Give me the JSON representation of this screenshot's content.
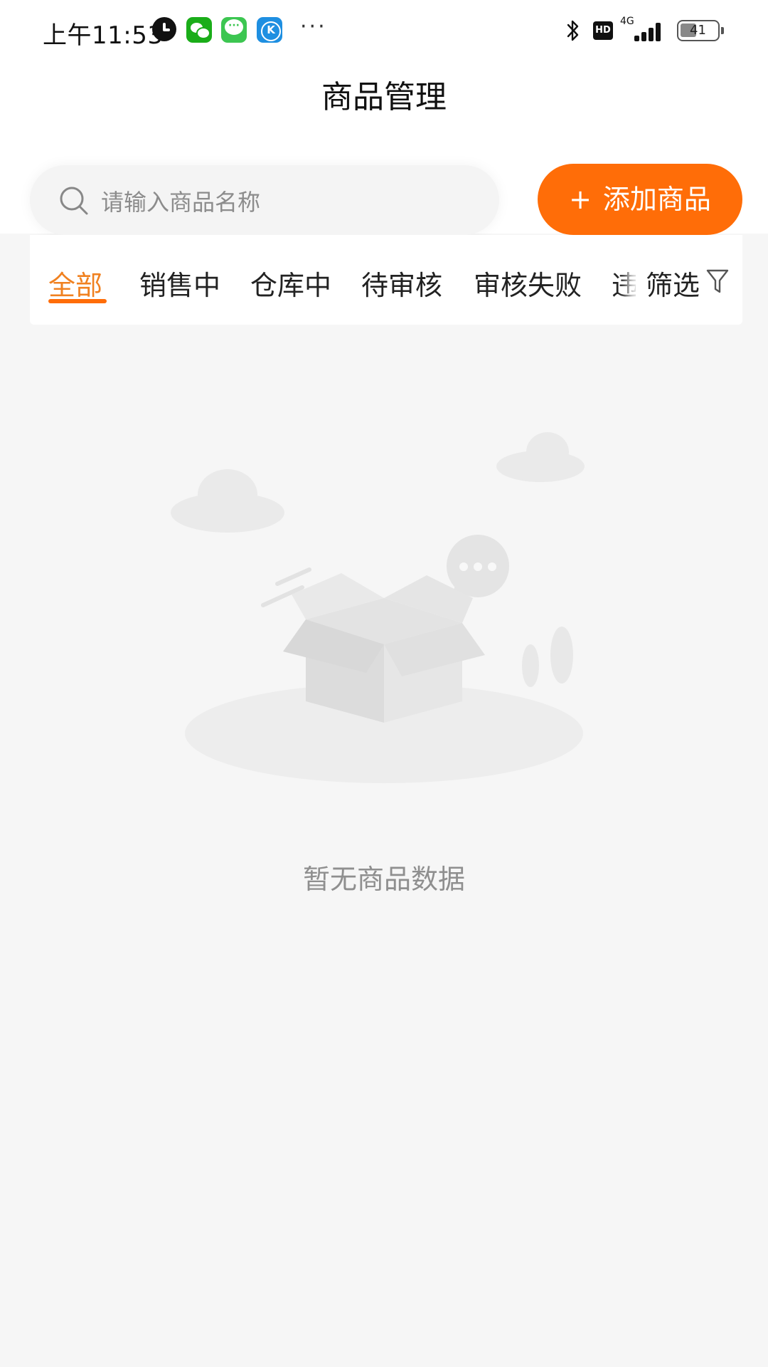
{
  "status_bar": {
    "time": "上午11:53",
    "network": "4G",
    "hd": "HD",
    "battery": "41",
    "more": "···",
    "icons": [
      "alarm-icon",
      "wechat-icon",
      "message-icon",
      "k-app-icon",
      "bluetooth-icon",
      "signal-icon",
      "battery-icon"
    ]
  },
  "header": {
    "title": "商品管理"
  },
  "search": {
    "placeholder": "请输入商品名称"
  },
  "add_button": {
    "plus": "+",
    "label": "添加商品"
  },
  "tabs": [
    {
      "label": "全部",
      "active": true
    },
    {
      "label": "销售中",
      "active": false
    },
    {
      "label": "仓库中",
      "active": false
    },
    {
      "label": "待审核",
      "active": false
    },
    {
      "label": "审核失败",
      "active": false
    },
    {
      "label": "违",
      "active": false
    }
  ],
  "filter": {
    "label": "筛选"
  },
  "empty_state": {
    "message": "暂无商品数据"
  },
  "colors": {
    "accent": "#ff6d08",
    "active_tab": "#f08120",
    "background": "#f6f6f6"
  }
}
